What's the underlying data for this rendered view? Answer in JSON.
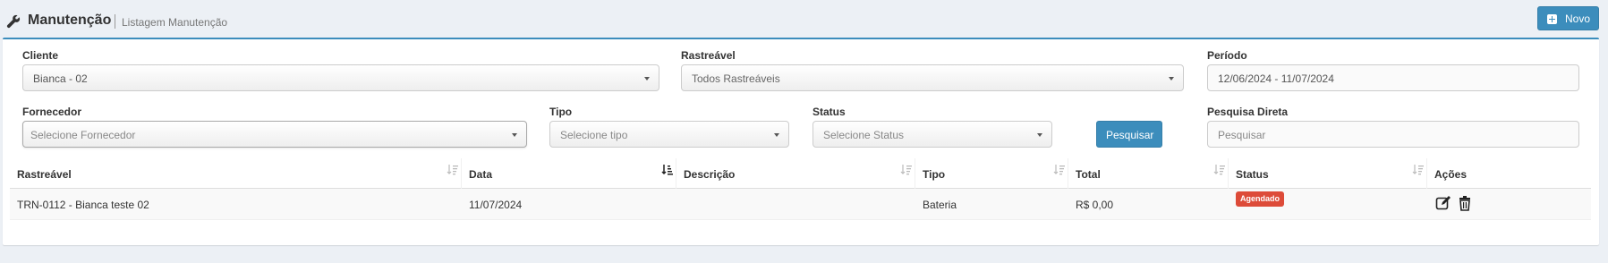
{
  "header": {
    "title": "Manutenção",
    "subtitle": "Listagem Manutenção",
    "new_button": "Novo"
  },
  "filters": {
    "cliente": {
      "label": "Cliente",
      "value": "Bianca - 02"
    },
    "rastreavel": {
      "label": "Rastreável",
      "value": "Todos Rastreáveis"
    },
    "periodo": {
      "label": "Período",
      "value": "12/06/2024 - 11/07/2024"
    },
    "fornecedor": {
      "label": "Fornecedor",
      "placeholder": "Selecione Fornecedor"
    },
    "tipo": {
      "label": "Tipo",
      "placeholder": "Selecione tipo"
    },
    "status": {
      "label": "Status",
      "placeholder": "Selecione Status"
    },
    "search_button": "Pesquisar",
    "direct": {
      "label": "Pesquisa Direta",
      "placeholder": "Pesquisar"
    }
  },
  "table": {
    "columns": [
      "Rastreável",
      "Data",
      "Descrição",
      "Tipo",
      "Total",
      "Status",
      "Ações"
    ],
    "rows": [
      {
        "rastreavel": "TRN-0112 - Bianca teste 02",
        "data": "11/07/2024",
        "descricao": "",
        "tipo": "Bateria",
        "total": "R$ 0,00",
        "status": "Agendado"
      }
    ]
  },
  "colors": {
    "primary": "#3c8dbc",
    "danger": "#dd4b39",
    "background": "#ecf0f5"
  },
  "icons": [
    "wrench-icon",
    "plus-square-icon",
    "sort-icon",
    "sort-active-icon",
    "edit-icon",
    "trash-icon",
    "caret-down-icon"
  ]
}
